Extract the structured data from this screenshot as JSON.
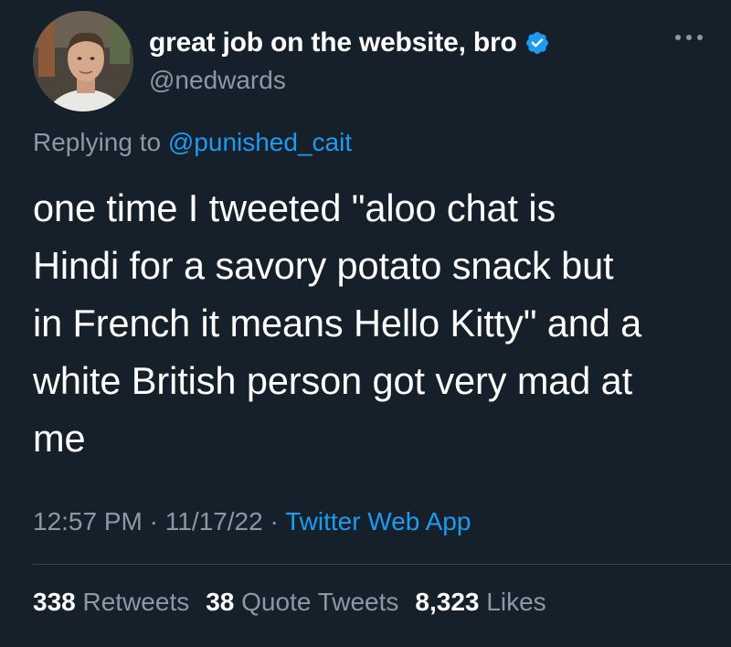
{
  "author": {
    "display_name": "great job on the website, bro",
    "handle": "@nedwards",
    "verified": true
  },
  "reply": {
    "prefix": "Replying to ",
    "mention": "@punished_cait"
  },
  "tweet": {
    "text": "one time I tweeted \"aloo chat is\nHindi for a savory potato snack but\nin French it means Hello Kitty\" and a\nwhite British person got very mad at\nme"
  },
  "meta": {
    "time": "12:57 PM",
    "separator": " · ",
    "date": "11/17/22",
    "app": "Twitter Web App"
  },
  "stats": {
    "retweets_count": "338",
    "retweets_label": "Retweets",
    "quotes_count": "38",
    "quotes_label": "Quote Tweets",
    "likes_count": "8,323",
    "likes_label": "Likes"
  },
  "colors": {
    "background": "#15202b",
    "primary_text": "#ffffff",
    "secondary_text": "#8b98a5",
    "accent": "#1d9bf0",
    "divider": "#38444d"
  }
}
